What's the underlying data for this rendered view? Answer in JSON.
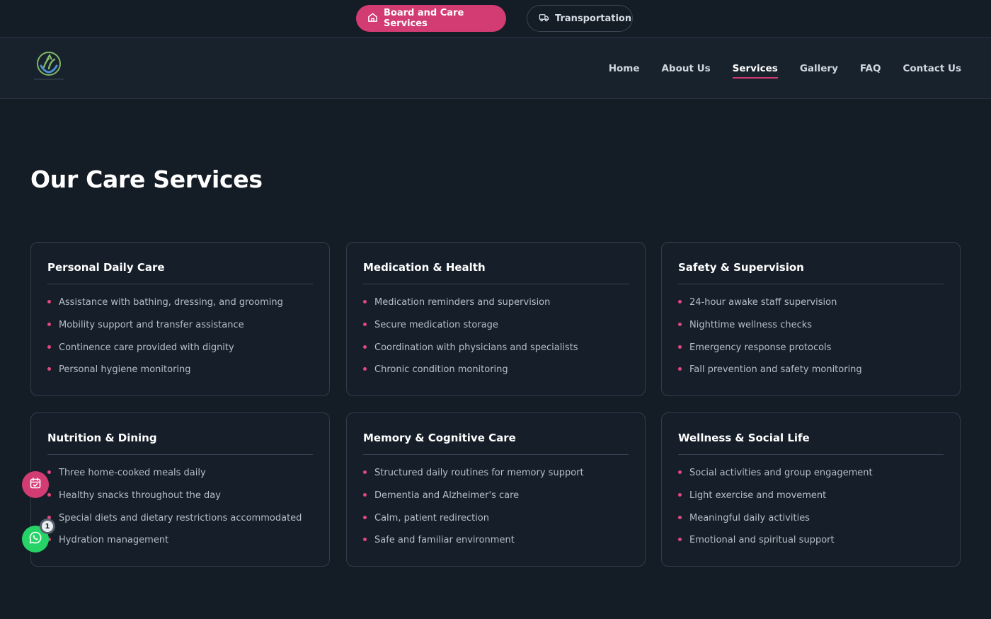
{
  "top_toggle": {
    "active_label": "Board and Care Services",
    "active_icon": "home-icon",
    "inactive_label": "Transportation",
    "inactive_icon": "truck-icon",
    "accent_color": "#d23c72"
  },
  "nav": {
    "items": [
      {
        "label": "Home"
      },
      {
        "label": "About Us"
      },
      {
        "label": "Services",
        "current": true
      },
      {
        "label": "Gallery"
      },
      {
        "label": "FAQ"
      },
      {
        "label": "Contact Us"
      }
    ]
  },
  "page": {
    "heading": "Our Care Services"
  },
  "cards": [
    {
      "title": "Personal Daily Care",
      "items": [
        "Assistance with bathing, dressing, and grooming",
        "Mobility support and transfer assistance",
        "Continence care provided with dignity",
        "Personal hygiene monitoring"
      ]
    },
    {
      "title": "Medication & Health",
      "items": [
        "Medication reminders and supervision",
        "Secure medication storage",
        "Coordination with physicians and specialists",
        "Chronic condition monitoring"
      ]
    },
    {
      "title": "Safety & Supervision",
      "items": [
        "24-hour awake staff supervision",
        "Nighttime wellness checks",
        "Emergency response protocols",
        "Fall prevention and safety monitoring"
      ]
    },
    {
      "title": "Nutrition & Dining",
      "items": [
        "Three home-cooked meals daily",
        "Healthy snacks throughout the day",
        "Special diets and dietary restrictions accommodated",
        "Hydration management"
      ]
    },
    {
      "title": "Memory & Cognitive Care",
      "items": [
        "Structured daily routines for memory support",
        "Dementia and Alzheimer's care",
        "Calm, patient redirection",
        "Safe and familiar environment"
      ]
    },
    {
      "title": "Wellness & Social Life",
      "items": [
        "Social activities and group engagement",
        "Light exercise and movement",
        "Meaningful daily activities",
        "Emotional and spiritual support"
      ]
    }
  ],
  "floating": {
    "calendar_icon": "calendar-check-icon",
    "whatsapp_icon": "whatsapp-icon",
    "whatsapp_badge": "1"
  }
}
